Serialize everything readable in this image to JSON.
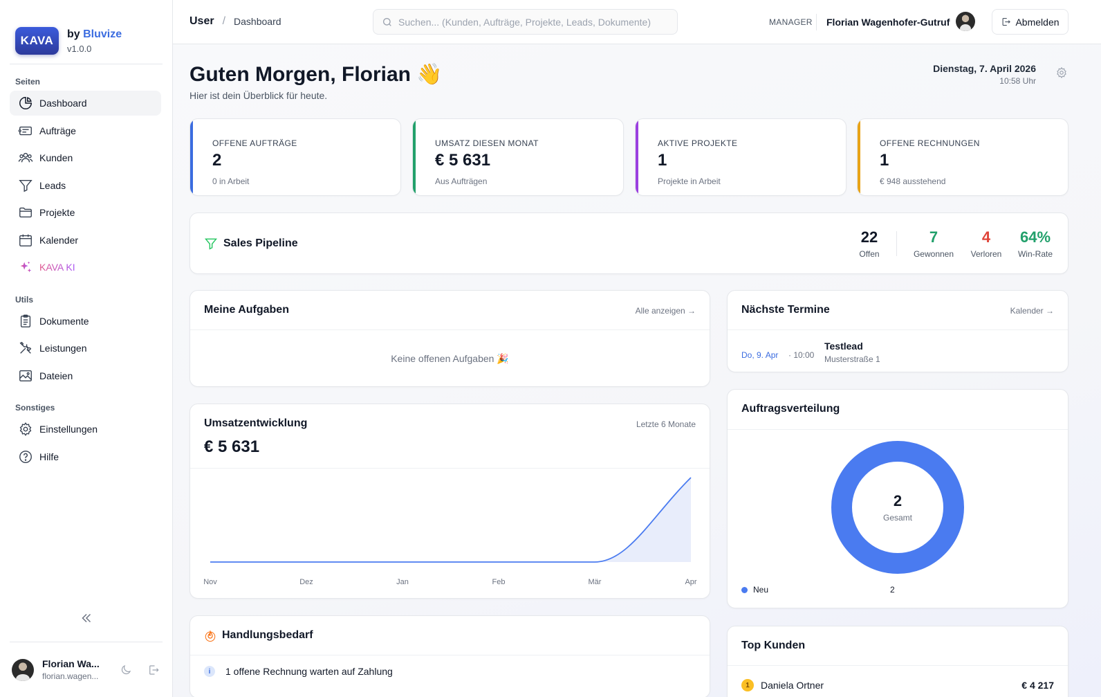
{
  "brand": {
    "logo_text": "KAVA",
    "by_prefix": "by",
    "by_name": "Bluvize",
    "version": "v1.0.0",
    "accent_color": "#3b6ce0"
  },
  "sidebar": {
    "groups": [
      {
        "title": "Seiten",
        "items": [
          {
            "label": "Dashboard",
            "icon": "pie-chart-icon",
            "active": true
          },
          {
            "label": "Aufträge",
            "icon": "ticket-icon"
          },
          {
            "label": "Kunden",
            "icon": "users-icon"
          },
          {
            "label": "Leads",
            "icon": "funnel-icon"
          },
          {
            "label": "Projekte",
            "icon": "folder-icon"
          },
          {
            "label": "Kalender",
            "icon": "calendar-icon"
          },
          {
            "label": "KAVA KI",
            "icon": "sparkles-icon"
          }
        ]
      },
      {
        "title": "Utils",
        "items": [
          {
            "label": "Dokumente",
            "icon": "clipboard-icon"
          },
          {
            "label": "Leistungen",
            "icon": "tools-icon"
          },
          {
            "label": "Dateien",
            "icon": "image-icon"
          }
        ]
      },
      {
        "title": "Sonstiges",
        "items": [
          {
            "label": "Einstellungen",
            "icon": "gear-icon"
          },
          {
            "label": "Hilfe",
            "icon": "help-icon"
          }
        ]
      }
    ],
    "footer": {
      "name": "Florian Wa...",
      "email": "florian.wagen..."
    }
  },
  "topbar": {
    "breadcrumb": [
      "User",
      "Dashboard"
    ],
    "search_placeholder": "Suchen... (Kunden, Aufträge, Projekte, Leads, Dokumente)",
    "role": "MANAGER",
    "user_name": "Florian Wagenhofer-Gutruf",
    "logout_label": "Abmelden"
  },
  "header": {
    "greeting": "Guten Morgen, Florian 👋",
    "subtitle": "Hier ist dein Überblick für heute.",
    "date": "Dienstag, 7. April 2026",
    "time": "10:58 Uhr"
  },
  "stats": [
    {
      "label": "OFFENE AUFTRÄGE",
      "value": "2",
      "sub": "0 in Arbeit",
      "color": "#3b6ce0"
    },
    {
      "label": "UMSATZ DIESEN MONAT",
      "value": "€ 5 631",
      "sub": "Aus Aufträgen",
      "color": "#22a06b"
    },
    {
      "label": "AKTIVE PROJEKTE",
      "value": "1",
      "sub": "Projekte in Arbeit",
      "color": "#9b3fe0"
    },
    {
      "label": "OFFENE RECHNUNGEN",
      "value": "1",
      "sub": "€ 948 ausstehend",
      "color": "#e8a317"
    }
  ],
  "pipeline": {
    "title": "Sales Pipeline",
    "offen": {
      "value": "22",
      "label": "Offen"
    },
    "gewonnen": {
      "value": "7",
      "label": "Gewonnen",
      "color": "#22a06b"
    },
    "verloren": {
      "value": "4",
      "label": "Verloren",
      "color": "#e0453a"
    },
    "winrate": {
      "value": "64%",
      "label": "Win-Rate",
      "color": "#22a06b"
    }
  },
  "tasks": {
    "title": "Meine Aufgaben",
    "link": "Alle anzeigen →",
    "empty": "Keine offenen Aufgaben 🎉"
  },
  "appointments": {
    "title": "Nächste Termine",
    "link": "Kalender →",
    "items": [
      {
        "date": "Do, 9. Apr",
        "time": "· 10:00",
        "title": "Testlead",
        "address": "Musterstraße 1"
      }
    ]
  },
  "revenue": {
    "title": "Umsatzentwicklung",
    "period": "Letzte 6 Monate",
    "total": "€ 5 631"
  },
  "distribution": {
    "title": "Auftragsverteilung",
    "total": "2",
    "total_label": "Gesamt",
    "legend": [
      {
        "label": "Neu",
        "value": "2",
        "color": "#4a7bf0"
      }
    ]
  },
  "actions": {
    "title": "Handlungsbedarf",
    "items": [
      {
        "icon": "info-icon",
        "text": "1 offene Rechnung warten auf Zahlung"
      }
    ]
  },
  "top_customers": {
    "title": "Top Kunden",
    "items": [
      {
        "rank": "1",
        "name": "Daniela Ortner",
        "amount": "€ 4 217"
      }
    ]
  },
  "chart_data": [
    {
      "type": "area",
      "title": "Umsatzentwicklung",
      "categories": [
        "Nov",
        "Dez",
        "Jan",
        "Feb",
        "Mär",
        "Apr"
      ],
      "series": [
        {
          "values": [
            0,
            0,
            0,
            0,
            0,
            5631
          ]
        }
      ],
      "color": "#4a7bf0",
      "grid": false
    },
    {
      "type": "pie",
      "title": "Auftragsverteilung",
      "categories": [
        "Neu"
      ],
      "values": [
        2
      ],
      "colors": [
        "#4a7bf0"
      ]
    }
  ]
}
